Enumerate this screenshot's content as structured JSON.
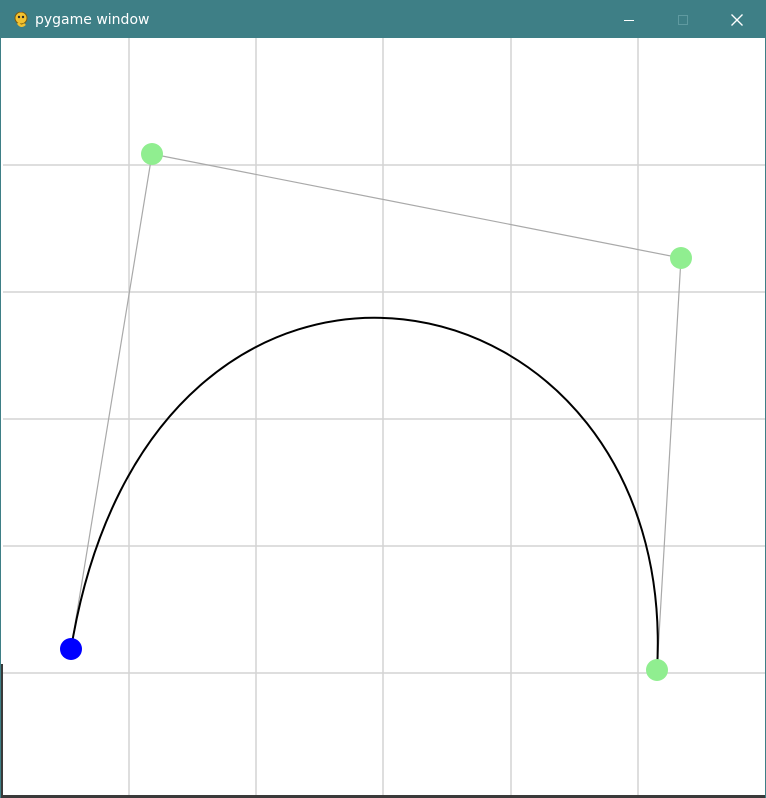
{
  "window": {
    "title": "pygame window",
    "titlebar_color": "#3e7f86",
    "app_icon": "pygame-snake-icon",
    "controls": {
      "minimize_icon": "minimize-icon",
      "maximize_icon": "maximize-icon",
      "close_icon": "close-icon"
    }
  },
  "canvas": {
    "background": "#ffffff",
    "grid_color": "#d3d3d3",
    "curve_color": "#000000",
    "control_polygon_color": "#a9a9a9",
    "selected_point_color": "#0000ff",
    "control_point_color": "#90ee90",
    "curve_type": "cubic-bezier",
    "control_point_count": 4,
    "selected_point_index": 0
  }
}
